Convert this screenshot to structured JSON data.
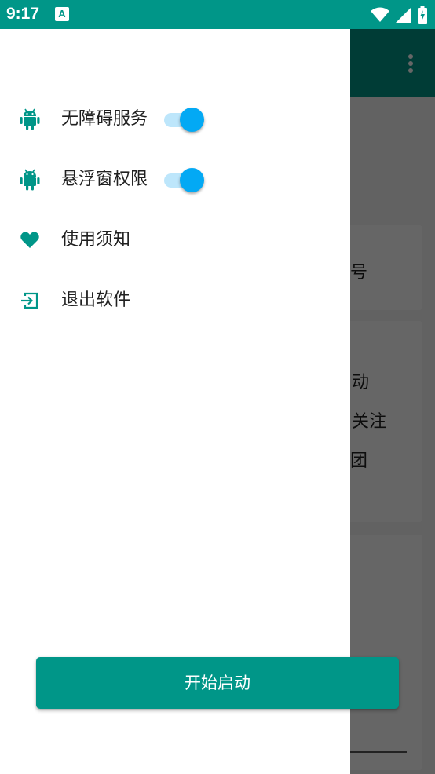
{
  "status_bar": {
    "time": "9:17",
    "notification_letter": "A",
    "icons": [
      "wifi-icon",
      "signal-icon",
      "battery-icon"
    ]
  },
  "background": {
    "fragments": [
      "号",
      "动",
      "关注",
      "团"
    ]
  },
  "drawer": {
    "items": [
      {
        "label": "无障碍服务",
        "icon": "android-icon",
        "toggle": true,
        "toggled_on": true
      },
      {
        "label": "悬浮窗权限",
        "icon": "android-icon",
        "toggle": true,
        "toggled_on": true
      },
      {
        "label": "使用须知",
        "icon": "heart-icon",
        "toggle": false
      },
      {
        "label": "退出软件",
        "icon": "exit-icon",
        "toggle": false
      }
    ]
  },
  "start_button": {
    "label": "开始启动"
  },
  "colors": {
    "primary": "#009688",
    "switch_thumb": "#03a9f4",
    "switch_track": "#bde6fb"
  }
}
